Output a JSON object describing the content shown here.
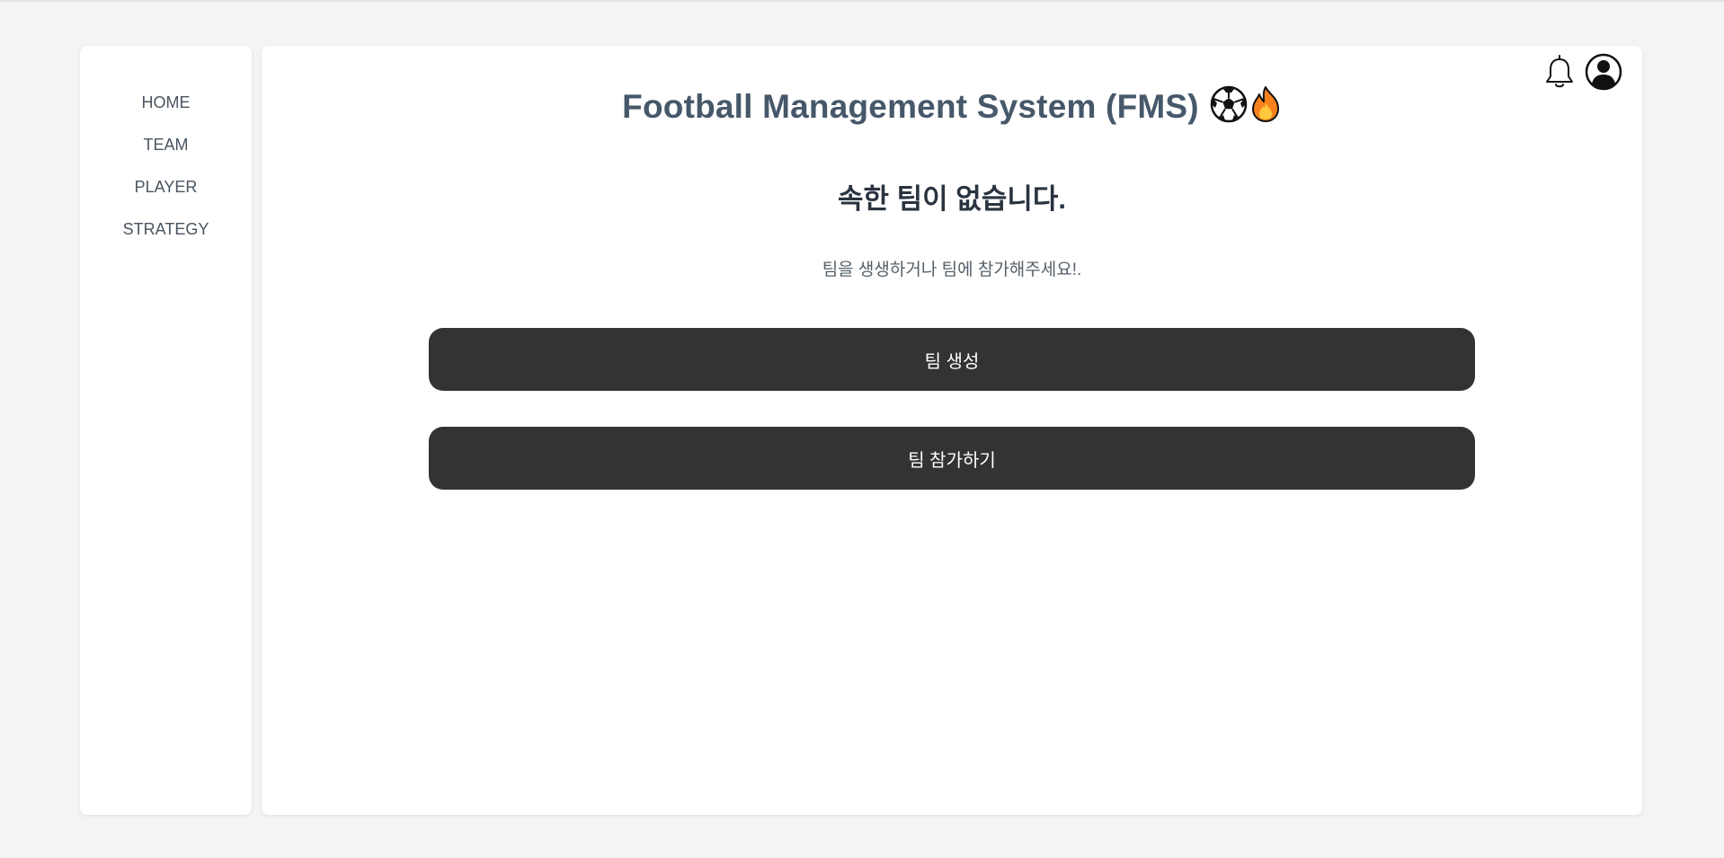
{
  "sidebar": {
    "items": [
      {
        "label": "HOME"
      },
      {
        "label": "TEAM"
      },
      {
        "label": "PLAYER"
      },
      {
        "label": "STRATEGY"
      }
    ]
  },
  "header": {
    "title": "Football Management System (FMS)",
    "emojis": [
      "soccer-ball-icon",
      "fire-icon"
    ],
    "icons": [
      "bell-icon",
      "user-profile-icon"
    ]
  },
  "main": {
    "heading": "속한 팀이 없습니다.",
    "subtext": "팀을 생생하거나 팀에 참가해주세요!.",
    "create_button_label": "팀 생성",
    "join_button_label": "팀 참가하기"
  },
  "colors": {
    "background": "#f4f4f4",
    "panel": "#ffffff",
    "title": "#46586a",
    "button": "#333333",
    "button_text": "#ffffff"
  }
}
